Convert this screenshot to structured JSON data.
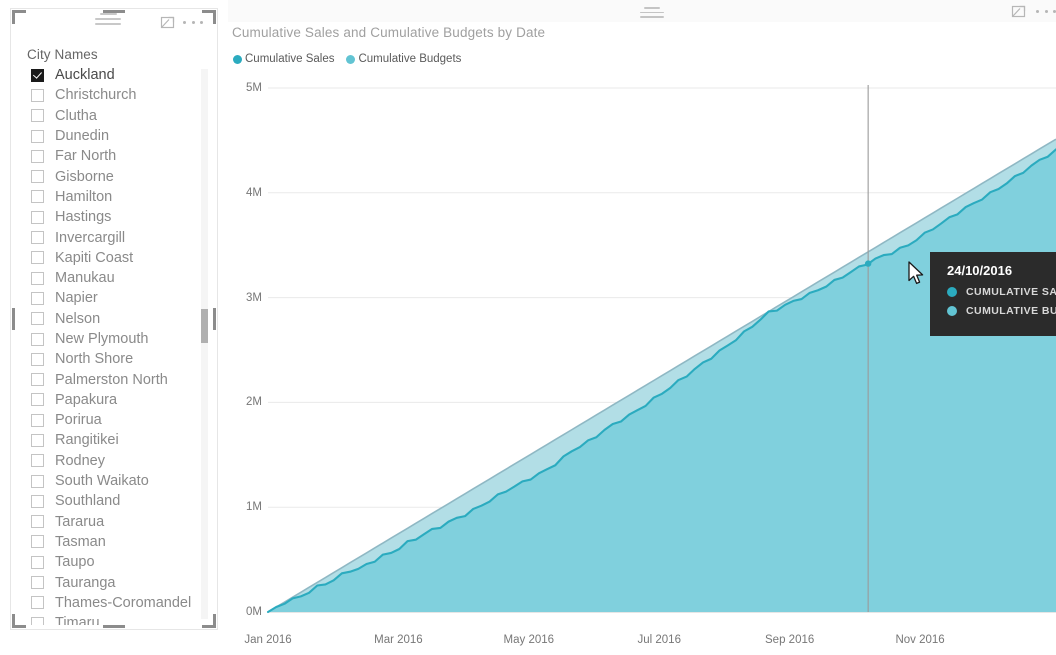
{
  "slicer": {
    "title": "City Names",
    "icons": {
      "hamburger": "hamburger-icon",
      "focus": "focus-mode-icon",
      "ellipsis": "more-options-icon"
    },
    "items": [
      {
        "label": "Auckland",
        "checked": true
      },
      {
        "label": "Christchurch",
        "checked": false
      },
      {
        "label": "Clutha",
        "checked": false
      },
      {
        "label": "Dunedin",
        "checked": false
      },
      {
        "label": "Far North",
        "checked": false
      },
      {
        "label": "Gisborne",
        "checked": false
      },
      {
        "label": "Hamilton",
        "checked": false
      },
      {
        "label": "Hastings",
        "checked": false
      },
      {
        "label": "Invercargill",
        "checked": false
      },
      {
        "label": "Kapiti Coast",
        "checked": false
      },
      {
        "label": "Manukau",
        "checked": false
      },
      {
        "label": "Napier",
        "checked": false
      },
      {
        "label": "Nelson",
        "checked": false
      },
      {
        "label": "New Plymouth",
        "checked": false
      },
      {
        "label": "North Shore",
        "checked": false
      },
      {
        "label": "Palmerston North",
        "checked": false
      },
      {
        "label": "Papakura",
        "checked": false
      },
      {
        "label": "Porirua",
        "checked": false
      },
      {
        "label": "Rangitikei",
        "checked": false
      },
      {
        "label": "Rodney",
        "checked": false
      },
      {
        "label": "South Waikato",
        "checked": false
      },
      {
        "label": "Southland",
        "checked": false
      },
      {
        "label": "Tararua",
        "checked": false
      },
      {
        "label": "Tasman",
        "checked": false
      },
      {
        "label": "Taupo",
        "checked": false
      },
      {
        "label": "Tauranga",
        "checked": false
      },
      {
        "label": "Thames-Coromandel",
        "checked": false
      },
      {
        "label": "Timaru",
        "checked": false
      }
    ]
  },
  "chart_panel": {
    "icons": {
      "drag": "drag-handle-icon",
      "focus": "focus-mode-icon",
      "ellipsis": "more-options-icon"
    }
  },
  "tooltip": {
    "date": "24/10/2016",
    "rows": [
      {
        "label": "CUMULATIVE SALES",
        "color": "#2BABBF"
      },
      {
        "label": "CUMULATIVE BUDGETS",
        "color": "#62C4D3"
      }
    ]
  },
  "chart_data": {
    "type": "area",
    "title": "Cumulative Sales and Cumulative Budgets by Date",
    "xlabel": "",
    "ylabel": "",
    "grid": true,
    "legend_position": "top-left",
    "ylim": [
      0,
      5000000
    ],
    "ytick_labels": [
      "0M",
      "1M",
      "2M",
      "3M",
      "4M",
      "5M"
    ],
    "ytick_values": [
      0,
      1000000,
      2000000,
      3000000,
      4000000,
      5000000
    ],
    "xtick_labels": [
      "Jan 2016",
      "Mar 2016",
      "May 2016",
      "Jul 2016",
      "Sep 2016",
      "Nov 2016"
    ],
    "xtick_positions": [
      0.0,
      0.1655,
      0.331,
      0.4965,
      0.662,
      0.8275
    ],
    "colors": {
      "cumulative_sales_line": "#2BABBF",
      "cumulative_sales_fill": "#7ECFDC",
      "cumulative_budgets_line": "#8FB8C4",
      "cumulative_budgets_fill": "#AEDCE5",
      "gridline": "#EAEAEA",
      "crosshair": "#9A9A9A"
    },
    "crosshair_x": 0.7616,
    "series": [
      {
        "name": "Cumulative Sales",
        "color": "#2BABBF",
        "values": [
          0,
          42000,
          98000,
          130000,
          152000,
          196000,
          238000,
          262000,
          300000,
          350000,
          392000,
          410000,
          455000,
          500000,
          546000,
          568000,
          612000,
          660000,
          690000,
          738000,
          775000,
          812000,
          860000,
          898000,
          935000,
          980000,
          1020000,
          1062000,
          1105000,
          1150000,
          1190000,
          1230000,
          1275000,
          1320000,
          1365000,
          1420000,
          1480000,
          1540000,
          1580000,
          1620000,
          1670000,
          1730000,
          1780000,
          1830000,
          1880000,
          1930000,
          1985000,
          2040000,
          2090000,
          2140000,
          2195000,
          2250000,
          2310000,
          2370000,
          2430000,
          2490000,
          2550000,
          2610000,
          2670000,
          2730000,
          2790000,
          2850000,
          2880000,
          2920000,
          2960000,
          3000000,
          3040000,
          3080000,
          3120000,
          3160000,
          3200000,
          3240000,
          3280000,
          3320000,
          3360000,
          3400000,
          3430000,
          3470000,
          3510000,
          3560000,
          3610000,
          3660000,
          3700000,
          3750000,
          3800000,
          3850000,
          3900000,
          3950000,
          4000000,
          4050000,
          4100000,
          4150000,
          4200000,
          4250000,
          4300000,
          4350000,
          4400000
        ]
      },
      {
        "name": "Cumulative Budgets",
        "color": "#8FB8C4",
        "values": [
          0,
          47000,
          94000,
          141000,
          188000,
          235000,
          282000,
          329000,
          376000,
          423000,
          470000,
          517000,
          564000,
          611000,
          658000,
          705000,
          752000,
          799000,
          846000,
          893000,
          940000,
          987000,
          1034000,
          1081000,
          1128000,
          1175000,
          1222000,
          1269000,
          1316000,
          1363000,
          1410000,
          1457000,
          1504000,
          1551000,
          1598000,
          1645000,
          1692000,
          1739000,
          1786000,
          1833000,
          1880000,
          1927000,
          1974000,
          2021000,
          2068000,
          2115000,
          2162000,
          2209000,
          2256000,
          2303000,
          2350000,
          2397000,
          2444000,
          2491000,
          2538000,
          2585000,
          2632000,
          2679000,
          2726000,
          2773000,
          2820000,
          2867000,
          2914000,
          2961000,
          3008000,
          3055000,
          3102000,
          3149000,
          3196000,
          3243000,
          3290000,
          3337000,
          3384000,
          3431000,
          3478000,
          3525000,
          3572000,
          3619000,
          3666000,
          3713000,
          3760000,
          3807000,
          3854000,
          3901000,
          3948000,
          3995000,
          4042000,
          4089000,
          4136000,
          4183000,
          4230000,
          4277000,
          4324000,
          4371000,
          4418000,
          4465000,
          4512000
        ]
      }
    ]
  }
}
